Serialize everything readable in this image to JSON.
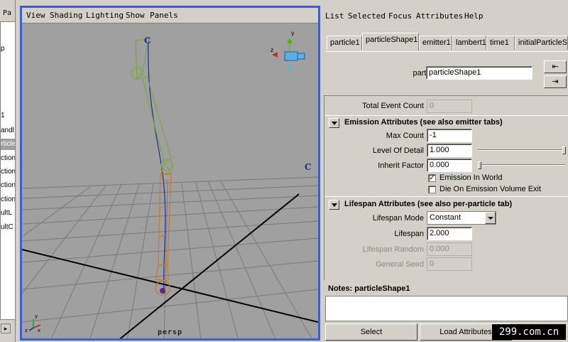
{
  "outliner": {
    "header": "Pa",
    "items": [
      {
        "label": "p"
      },
      {
        "label": "1"
      },
      {
        "label": "andl"
      },
      {
        "label": "rticle1"
      },
      {
        "label": "ction"
      },
      {
        "label": "ction"
      },
      {
        "label": "ction"
      },
      {
        "label": "ction"
      },
      {
        "label": "ultL"
      },
      {
        "label": "ultC"
      }
    ]
  },
  "viewport": {
    "menu": [
      "View",
      "Shading",
      "Lighting",
      "Show",
      "Panels"
    ],
    "camera_label": "persp",
    "markers": [
      "C",
      "C"
    ],
    "accent_color": "#3c5ed0"
  },
  "attribute_editor": {
    "menu": [
      "List",
      "Selected",
      "Focus",
      "Attributes",
      "Help"
    ],
    "tabs": [
      "particle1",
      "particleShape1",
      "emitter1",
      "lambert1",
      "time1",
      "initialParticleSE"
    ],
    "active_tab": "particleShape1",
    "node_label": "particle:",
    "node_value": "particleShape1",
    "total_event_count_label": "Total Event Count",
    "total_event_count_value": "0",
    "emission": {
      "title": "Emission Attributes (see also emitter tabs)",
      "max_count_label": "Max Count",
      "max_count_value": "-1",
      "level_of_detail_label": "Level Of Detail",
      "level_of_detail_value": "1.000",
      "inherit_factor_label": "Inherit Factor",
      "inherit_factor_value": "0.000",
      "emission_in_world_label": "Emission In World",
      "emission_in_world_checked": true,
      "die_on_exit_label": "Die On Emission Volume Exit",
      "die_on_exit_checked": false
    },
    "lifespan": {
      "title": "Lifespan Attributes (see also per-particle tab)",
      "mode_label": "Lifespan Mode",
      "mode_value": "Constant",
      "lifespan_label": "Lifespan",
      "lifespan_value": "2.000",
      "random_label": "Lifespan Random",
      "random_value": "0.000",
      "seed_label": "General Seed",
      "seed_value": "0"
    },
    "notes_title": "Notes:  particleShape1",
    "select_button": "Select",
    "load_button": "Load Attributes"
  },
  "watermark": "299.com.cn"
}
